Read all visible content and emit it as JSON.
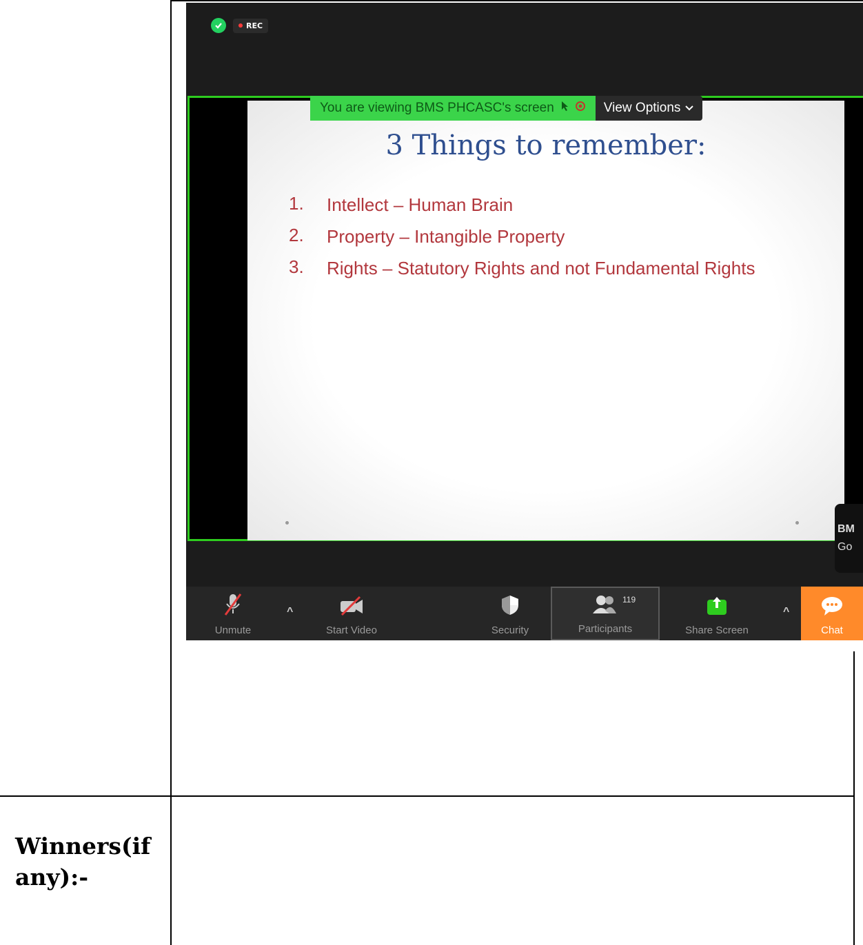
{
  "doc": {
    "winners_label": "Winners(if any):-"
  },
  "zoom": {
    "rec_label": "REC",
    "banner_text": "You are viewing BMS PHCASC's screen",
    "view_options": "View Options",
    "slide": {
      "title": "3 Things to remember:",
      "points": [
        {
          "num": "1.",
          "text": "Intellect – Human Brain"
        },
        {
          "num": "2.",
          "text": "Property – Intangible Property"
        },
        {
          "num": "3.",
          "text": "Rights – Statutory Rights and not Fundamental Rights"
        }
      ]
    },
    "name_tag": [
      "BM",
      "Go"
    ],
    "toolbar": {
      "unmute": "Unmute",
      "start_video": "Start Video",
      "security": "Security",
      "participants": "Participants",
      "participants_count": "119",
      "share_screen": "Share Screen",
      "chat": "Chat"
    }
  },
  "colors": {
    "share_border": "#2ecc1f",
    "slide_title": "#2f4f8f",
    "slide_points": "#b2373d",
    "share_icon": "#2ecc1f",
    "chat_bg": "#ff8a2a"
  },
  "icons": [
    "shield-check-icon",
    "mic-muted-icon",
    "video-off-icon",
    "security-shield-icon",
    "participants-icon",
    "share-screen-icon",
    "chat-bubble-icon",
    "caret-up-icon",
    "chevron-down-icon"
  ]
}
